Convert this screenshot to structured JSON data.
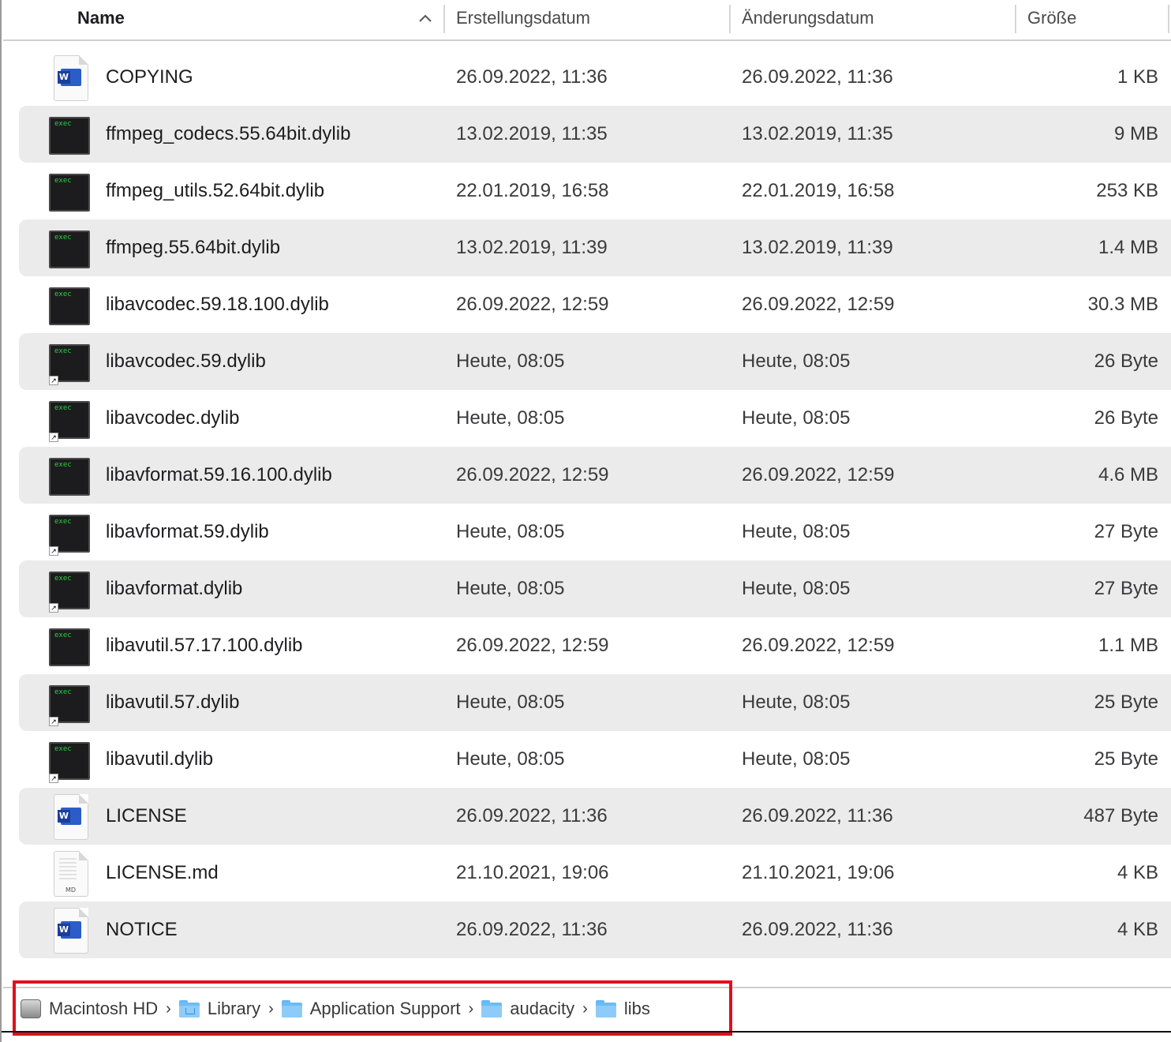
{
  "columns": {
    "name": "Name",
    "created": "Erstellungsdatum",
    "modified": "Änderungsdatum",
    "size": "Größe"
  },
  "files": [
    {
      "name": "COPYING",
      "created": "26.09.2022, 11:36",
      "modified": "26.09.2022, 11:36",
      "size": "1 KB",
      "icon": "word-document-icon"
    },
    {
      "name": "ffmpeg_codecs.55.64bit.dylib",
      "created": "13.02.2019, 11:35",
      "modified": "13.02.2019, 11:35",
      "size": "9 MB",
      "icon": "exec-icon"
    },
    {
      "name": "ffmpeg_utils.52.64bit.dylib",
      "created": "22.01.2019, 16:58",
      "modified": "22.01.2019, 16:58",
      "size": "253 KB",
      "icon": "exec-icon"
    },
    {
      "name": "ffmpeg.55.64bit.dylib",
      "created": "13.02.2019, 11:39",
      "modified": "13.02.2019, 11:39",
      "size": "1.4 MB",
      "icon": "exec-icon"
    },
    {
      "name": "libavcodec.59.18.100.dylib",
      "created": "26.09.2022, 12:59",
      "modified": "26.09.2022, 12:59",
      "size": "30.3 MB",
      "icon": "exec-icon"
    },
    {
      "name": "libavcodec.59.dylib",
      "created": "Heute, 08:05",
      "modified": "Heute, 08:05",
      "size": "26 Byte",
      "icon": "exec-alias-icon"
    },
    {
      "name": "libavcodec.dylib",
      "created": "Heute, 08:05",
      "modified": "Heute, 08:05",
      "size": "26 Byte",
      "icon": "exec-alias-icon"
    },
    {
      "name": "libavformat.59.16.100.dylib",
      "created": "26.09.2022, 12:59",
      "modified": "26.09.2022, 12:59",
      "size": "4.6 MB",
      "icon": "exec-icon"
    },
    {
      "name": "libavformat.59.dylib",
      "created": "Heute, 08:05",
      "modified": "Heute, 08:05",
      "size": "27 Byte",
      "icon": "exec-alias-icon"
    },
    {
      "name": "libavformat.dylib",
      "created": "Heute, 08:05",
      "modified": "Heute, 08:05",
      "size": "27 Byte",
      "icon": "exec-alias-icon"
    },
    {
      "name": "libavutil.57.17.100.dylib",
      "created": "26.09.2022, 12:59",
      "modified": "26.09.2022, 12:59",
      "size": "1.1 MB",
      "icon": "exec-icon"
    },
    {
      "name": "libavutil.57.dylib",
      "created": "Heute, 08:05",
      "modified": "Heute, 08:05",
      "size": "25 Byte",
      "icon": "exec-alias-icon"
    },
    {
      "name": "libavutil.dylib",
      "created": "Heute, 08:05",
      "modified": "Heute, 08:05",
      "size": "25 Byte",
      "icon": "exec-alias-icon"
    },
    {
      "name": "LICENSE",
      "created": "26.09.2022, 11:36",
      "modified": "26.09.2022, 11:36",
      "size": "487 Byte",
      "icon": "word-document-icon"
    },
    {
      "name": "LICENSE.md",
      "created": "21.10.2021, 19:06",
      "modified": "21.10.2021, 19:06",
      "size": "4 KB",
      "icon": "markdown-document-icon"
    },
    {
      "name": "NOTICE",
      "created": "26.09.2022, 11:36",
      "modified": "26.09.2022, 11:36",
      "size": "4 KB",
      "icon": "word-document-icon"
    }
  ],
  "exec_label": "exec",
  "md_label": "MD",
  "path": [
    {
      "label": "Macintosh HD",
      "icon": "hard-drive-icon"
    },
    {
      "label": "Library",
      "icon": "folder-icon"
    },
    {
      "label": "Application Support",
      "icon": "folder-icon"
    },
    {
      "label": "audacity",
      "icon": "folder-icon"
    },
    {
      "label": "libs",
      "icon": "folder-icon"
    }
  ],
  "colors": {
    "alt_row": "#ebebeb",
    "highlight": "#e0101c",
    "folder": "#6cbcf5"
  }
}
